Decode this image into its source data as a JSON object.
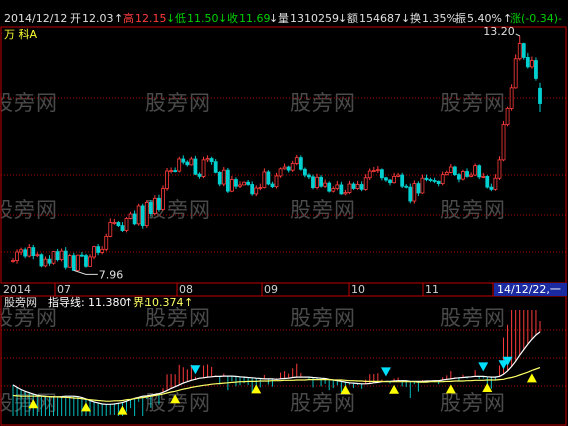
{
  "watermark": "股旁网",
  "info": {
    "date": "2014/12/12",
    "open_label": "开",
    "open": "12.03",
    "high_label": "高",
    "high": "12.15",
    "low_label": "低",
    "low": "11.50",
    "close_label": "收",
    "close": "11.69",
    "volume_label": "量",
    "volume": "1310259",
    "amount_label": "额",
    "amount": "154687",
    "turnover_label": "换",
    "turnover": "1.35%",
    "amplitude_label": "振",
    "amplitude": "5.40%",
    "change_label": "涨",
    "change": "(-0.34)-",
    "stock_name": "万 科A"
  },
  "markers": {
    "max": "13.20",
    "min": "7.96"
  },
  "date_axis": {
    "labels": [
      "2014",
      "07",
      "08",
      "09",
      "10",
      "11"
    ],
    "current": "14/12/22,一"
  },
  "indicator": {
    "name": "股旁网",
    "line_label": "指导线:",
    "line_value": "11.380",
    "bound_label": "界:",
    "bound_value": "10.374"
  },
  "colors": {
    "up": "#ff3c3c",
    "down": "#00d0d0",
    "line": "#ffffff",
    "bound": "#ffff66",
    "grid": "#b00000",
    "axis": "#c00000",
    "buy": "#ffff00",
    "sell": "#00e0ff"
  },
  "chart_data": {
    "type": "candlestick",
    "price_range": [
      7.7,
      13.4
    ],
    "close": [
      8.18,
      8.37,
      8.42,
      8.28,
      8.47,
      8.29,
      8.31,
      8.06,
      8.21,
      8.12,
      8.38,
      8.2,
      8.39,
      8.03,
      8.29,
      7.96,
      8.3,
      8.29,
      8.05,
      8.26,
      8.49,
      8.36,
      8.43,
      8.72,
      9.03,
      9.03,
      8.96,
      8.85,
      9.12,
      9.22,
      9.0,
      9.4,
      8.96,
      9.48,
      9.23,
      9.57,
      9.32,
      9.79,
      10.18,
      10.19,
      10.18,
      10.45,
      10.38,
      10.32,
      10.45,
      10.11,
      10.06,
      10.43,
      10.46,
      10.39,
      10.15,
      9.89,
      10.2,
      9.73,
      9.99,
      9.84,
      9.87,
      9.93,
      9.88,
      9.67,
      9.8,
      9.81,
      10.16,
      9.89,
      9.83,
      10.07,
      10.23,
      10.27,
      10.2,
      10.35,
      10.48,
      10.22,
      10.09,
      10.05,
      9.81,
      10.04,
      9.84,
      9.91,
      9.73,
      9.79,
      9.87,
      9.67,
      9.7,
      9.89,
      9.79,
      9.88,
      9.77,
      10.03,
      10.18,
      10.19,
      10.21,
      10.03,
      9.98,
      9.92,
      10.06,
      10.09,
      9.84,
      9.82,
      9.51,
      9.9,
      9.69,
      10.02,
      9.99,
      9.97,
      9.95,
      9.9,
      10.1,
      10.15,
      10.27,
      10.1,
      10.0,
      10.17,
      10.06,
      10.09,
      10.3,
      10.05,
      10.06,
      9.82,
      9.77,
      10.02,
      10.43,
      11.22,
      11.58,
      12.04,
      12.69,
      13.03,
      12.72,
      12.51,
      12.65,
      12.25,
      11.69
    ],
    "open": [
      8.17,
      8.18,
      8.37,
      8.42,
      8.28,
      8.47,
      8.29,
      8.31,
      8.06,
      8.21,
      8.12,
      8.38,
      8.2,
      8.39,
      8.03,
      8.29,
      7.96,
      8.3,
      8.29,
      8.05,
      8.26,
      8.49,
      8.36,
      8.43,
      8.72,
      9.03,
      9.03,
      8.96,
      8.85,
      9.12,
      9.22,
      9.0,
      9.4,
      8.96,
      9.48,
      9.23,
      9.57,
      9.32,
      9.79,
      10.18,
      10.19,
      10.18,
      10.45,
      10.38,
      10.32,
      10.45,
      10.11,
      10.06,
      10.43,
      10.46,
      10.39,
      10.15,
      9.89,
      10.2,
      9.73,
      9.99,
      9.84,
      9.87,
      9.93,
      9.88,
      9.67,
      9.8,
      9.81,
      10.16,
      9.89,
      9.83,
      10.07,
      10.23,
      10.27,
      10.2,
      10.35,
      10.48,
      10.22,
      10.09,
      10.05,
      9.81,
      10.04,
      9.84,
      9.91,
      9.73,
      9.79,
      9.87,
      9.67,
      9.7,
      9.89,
      9.79,
      9.88,
      9.77,
      10.03,
      10.18,
      10.19,
      10.21,
      10.03,
      9.98,
      9.92,
      10.06,
      10.09,
      9.84,
      9.82,
      9.51,
      9.9,
      9.69,
      10.02,
      9.99,
      9.97,
      9.95,
      9.9,
      10.1,
      10.15,
      10.27,
      10.1,
      10.0,
      10.17,
      10.06,
      10.09,
      10.3,
      10.05,
      10.06,
      9.82,
      9.77,
      10.02,
      10.43,
      11.22,
      11.58,
      12.04,
      12.69,
      13.03,
      12.72,
      12.51,
      12.65,
      12.03
    ],
    "high": [
      8.23,
      8.43,
      8.47,
      8.47,
      8.55,
      8.53,
      8.36,
      8.34,
      8.27,
      8.3,
      8.39,
      8.44,
      8.45,
      8.48,
      8.33,
      8.35,
      8.31,
      8.37,
      8.33,
      8.32,
      8.51,
      8.55,
      8.5,
      8.78,
      9.12,
      9.11,
      9.06,
      9.04,
      9.15,
      9.27,
      9.3,
      9.45,
      9.45,
      9.53,
      9.53,
      9.64,
      9.65,
      9.86,
      10.25,
      10.26,
      10.26,
      10.5,
      10.53,
      10.42,
      10.5,
      10.52,
      10.15,
      10.5,
      10.53,
      10.5,
      10.45,
      10.18,
      10.27,
      10.25,
      10.07,
      10.04,
      9.95,
      9.95,
      9.98,
      9.95,
      9.86,
      9.9,
      10.24,
      10.2,
      9.94,
      10.14,
      10.26,
      10.35,
      10.3,
      10.41,
      10.54,
      10.53,
      10.26,
      10.13,
      10.1,
      10.12,
      10.09,
      9.99,
      9.95,
      9.84,
      9.96,
      9.94,
      9.76,
      9.96,
      9.93,
      9.96,
      9.95,
      10.11,
      10.24,
      10.27,
      10.29,
      10.24,
      10.05,
      10.0,
      10.14,
      10.14,
      10.14,
      9.89,
      9.9,
      9.97,
      9.95,
      10.1,
      10.1,
      10.03,
      10.03,
      9.97,
      10.17,
      10.19,
      10.34,
      10.3,
      10.14,
      10.21,
      10.24,
      10.15,
      10.35,
      10.33,
      10.14,
      10.09,
      9.9,
      10.11,
      10.51,
      11.3,
      11.62,
      12.12,
      12.79,
      13.2,
      13.05,
      12.82,
      12.74,
      12.72,
      12.15
    ],
    "low": [
      8.13,
      8.11,
      8.3,
      8.23,
      8.25,
      8.21,
      8.26,
      8.03,
      8.03,
      8.06,
      8.09,
      8.16,
      8.16,
      7.98,
      8.02,
      7.96,
      7.96,
      8.26,
      8.02,
      8.04,
      8.21,
      8.3,
      8.32,
      8.39,
      8.7,
      8.98,
      8.93,
      8.82,
      8.81,
      9.1,
      8.97,
      8.96,
      8.89,
      8.91,
      9.16,
      9.19,
      9.27,
      9.29,
      9.74,
      10.13,
      10.15,
      10.15,
      10.33,
      10.28,
      10.3,
      10.09,
      10.01,
      10.02,
      10.38,
      10.32,
      10.13,
      9.84,
      9.84,
      9.69,
      9.71,
      9.78,
      9.8,
      9.86,
      9.85,
      9.63,
      9.62,
      9.75,
      9.79,
      9.86,
      9.8,
      9.79,
      10.03,
      10.21,
      10.15,
      10.16,
      10.31,
      10.19,
      10.04,
      10.0,
      9.77,
      9.77,
      9.81,
      9.8,
      9.7,
      9.7,
      9.75,
      9.65,
      9.64,
      9.67,
      9.76,
      9.76,
      9.73,
      9.74,
      9.98,
      10.15,
      10.14,
      9.97,
      9.94,
      9.86,
      9.9,
      10.04,
      9.8,
      9.79,
      9.46,
      9.45,
      9.62,
      9.67,
      9.95,
      9.93,
      9.91,
      9.84,
      9.86,
      10.08,
      10.13,
      10.07,
      9.93,
      9.97,
      10.03,
      10.04,
      10.07,
      10.0,
      10.02,
      9.79,
      9.73,
      9.74,
      9.98,
      10.4,
      11.18,
      11.53,
      12.02,
      12.65,
      12.67,
      12.47,
      12.47,
      12.2,
      11.5
    ],
    "guide_range": [
      9.0,
      12.0
    ],
    "guide_line": [
      9.88,
      9.81,
      9.75,
      9.7,
      9.66,
      9.62,
      9.59,
      9.57,
      9.56,
      9.55,
      9.54,
      9.54,
      9.55,
      9.56,
      9.56,
      9.56,
      9.55,
      9.52,
      9.48,
      9.44,
      9.4,
      9.37,
      9.34,
      9.33,
      9.33,
      9.34,
      9.36,
      9.38,
      9.42,
      9.46,
      9.5,
      9.53,
      9.56,
      9.57,
      9.59,
      9.61,
      9.63,
      9.67,
      9.72,
      9.78,
      9.83,
      9.88,
      9.93,
      9.97,
      10.01,
      10.04,
      10.07,
      10.08,
      10.1,
      10.11,
      10.12,
      10.12,
      10.13,
      10.13,
      10.13,
      10.12,
      10.11,
      10.1,
      10.09,
      10.08,
      10.07,
      10.06,
      10.05,
      10.05,
      10.05,
      10.04,
      10.05,
      10.06,
      10.07,
      10.09,
      10.1,
      10.1,
      10.1,
      10.1,
      10.09,
      10.08,
      10.07,
      10.06,
      10.04,
      10.02,
      10.0,
      9.98,
      9.96,
      9.94,
      9.93,
      9.92,
      9.91,
      9.91,
      9.92,
      9.94,
      9.95,
      9.97,
      9.98,
      9.98,
      9.99,
      10.0,
      10.0,
      10.0,
      9.98,
      9.98,
      9.98,
      9.98,
      9.99,
      9.99,
      10.0,
      10.0,
      10.02,
      10.04,
      10.05,
      10.07,
      10.08,
      10.09,
      10.1,
      10.11,
      10.12,
      10.12,
      10.12,
      10.11,
      10.1,
      10.1,
      10.12,
      10.18,
      10.28,
      10.4,
      10.55,
      10.72,
      10.88,
      11.03,
      11.17,
      11.29,
      11.38
    ],
    "bound_line": [
      9.58,
      9.57,
      9.56,
      9.56,
      9.56,
      9.56,
      9.56,
      9.56,
      9.55,
      9.55,
      9.54,
      9.54,
      9.53,
      9.53,
      9.52,
      9.51,
      9.5,
      9.49,
      9.47,
      9.46,
      9.45,
      9.44,
      9.43,
      9.42,
      9.42,
      9.43,
      9.43,
      9.44,
      9.46,
      9.47,
      9.49,
      9.51,
      9.52,
      9.54,
      9.56,
      9.58,
      9.6,
      9.62,
      9.65,
      9.68,
      9.7,
      9.73,
      9.76,
      9.78,
      9.81,
      9.83,
      9.85,
      9.87,
      9.88,
      9.9,
      9.91,
      9.92,
      9.93,
      9.94,
      9.95,
      9.96,
      9.97,
      9.97,
      9.98,
      9.98,
      9.98,
      9.99,
      9.99,
      9.99,
      10.0,
      10.0,
      10.0,
      10.01,
      10.01,
      10.01,
      10.02,
      10.02,
      10.02,
      10.03,
      10.03,
      10.03,
      10.03,
      10.03,
      10.03,
      10.02,
      10.02,
      10.02,
      10.01,
      10.0,
      10.0,
      9.99,
      9.99,
      9.98,
      9.98,
      9.98,
      9.98,
      9.98,
      9.97,
      9.97,
      9.97,
      9.97,
      9.97,
      9.97,
      9.97,
      9.97,
      9.96,
      9.96,
      9.96,
      9.97,
      9.97,
      9.97,
      9.97,
      9.98,
      9.98,
      9.99,
      9.99,
      9.99,
      10.0,
      10.0,
      10.01,
      10.01,
      10.01,
      10.02,
      10.02,
      10.02,
      10.03,
      10.04,
      10.07,
      10.09,
      10.12,
      10.16,
      10.2,
      10.24,
      10.29,
      10.33,
      10.37
    ],
    "buy_signals": [
      5,
      18,
      27,
      40,
      60,
      82,
      94,
      108,
      117,
      128
    ],
    "sell_signals": [
      45,
      92,
      116,
      121,
      122,
      131
    ]
  }
}
